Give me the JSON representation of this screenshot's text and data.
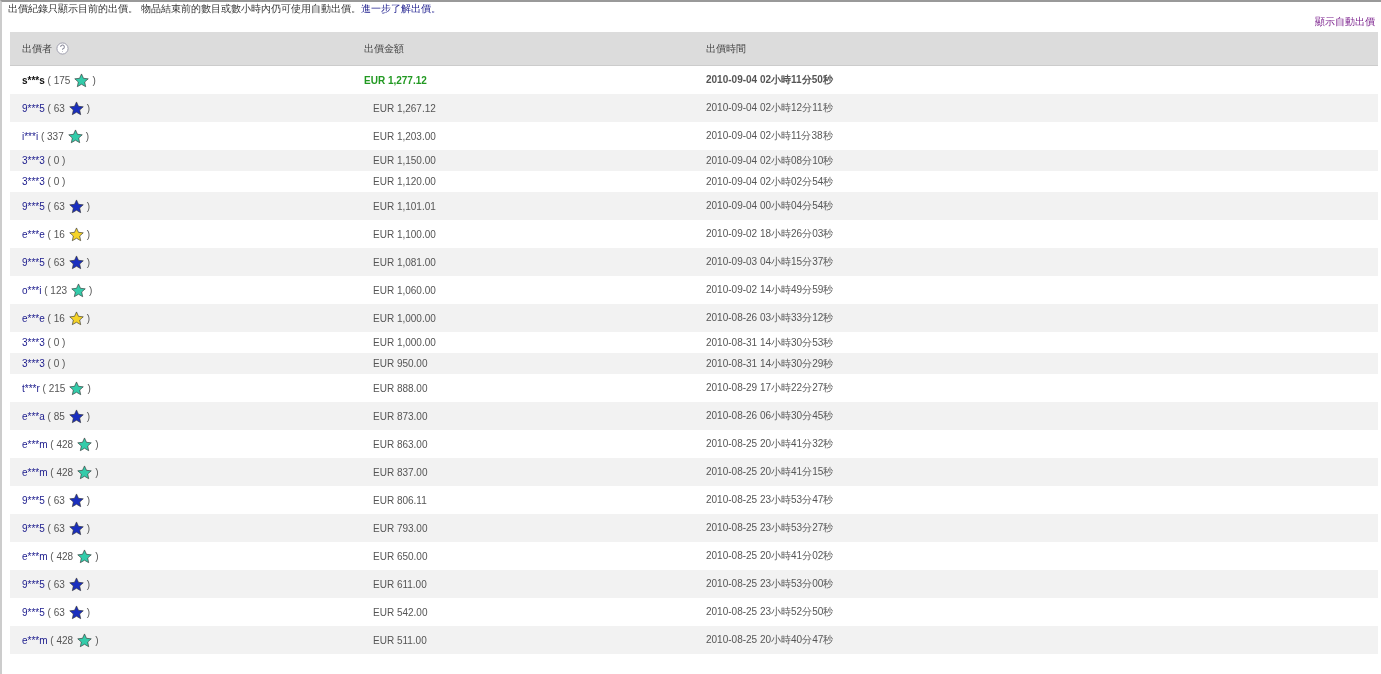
{
  "notice": {
    "text": "出價紀錄只顯示目前的出價。 物品結束前的數目或數小時內仍可使用自動出價。",
    "link": "進一步了解出價。"
  },
  "auto_bid_link": "顯示自動出價",
  "table": {
    "columns": [
      {
        "label": "出價者",
        "help": true
      },
      {
        "label": "出價金額",
        "help": false
      },
      {
        "label": "出價時間",
        "help": false
      }
    ],
    "rows": [
      {
        "bidder": "s***s",
        "score": "( 175",
        "color": "#33ccaa",
        "score_end": ")",
        "leading": true,
        "amount": "EUR 1,277.12",
        "time": "2010-09-04 02小時11分50秒"
      },
      {
        "bidder": "9***5",
        "score": "( 63",
        "color": "#1a2fbf",
        "score_end": ")",
        "leading": false,
        "amount": "EUR 1,267.12",
        "time": "2010-09-04 02小時12分11秒"
      },
      {
        "bidder": "i***i",
        "score": "( 337",
        "color": "#33ccaa",
        "score_end": ")",
        "leading": false,
        "amount": "EUR 1,203.00",
        "time": "2010-09-04 02小時11分38秒"
      },
      {
        "bidder": "3***3",
        "score": "( 0 )",
        "leading": false,
        "amount": "EUR 1,150.00",
        "time": "2010-09-04 02小時08分10秒"
      },
      {
        "bidder": "3***3",
        "score": "( 0 )",
        "leading": false,
        "amount": "EUR 1,120.00",
        "time": "2010-09-04 02小時02分54秒"
      },
      {
        "bidder": "9***5",
        "score": "( 63",
        "color": "#1a2fbf",
        "score_end": ")",
        "leading": false,
        "amount": "EUR 1,101.01",
        "time": "2010-09-04 00小時04分54秒"
      },
      {
        "bidder": "e***e",
        "score": "( 16",
        "color": "#f5d327",
        "score_end": ")",
        "leading": false,
        "amount": "EUR 1,100.00",
        "time": "2010-09-02 18小時26分03秒"
      },
      {
        "bidder": "9***5",
        "score": "( 63",
        "color": "#1a2fbf",
        "score_end": ")",
        "leading": false,
        "amount": "EUR 1,081.00",
        "time": "2010-09-03 04小時15分37秒"
      },
      {
        "bidder": "o***i",
        "score": "( 123",
        "color": "#33ccaa",
        "score_end": ")",
        "leading": false,
        "amount": "EUR 1,060.00",
        "time": "2010-09-02 14小時49分59秒"
      },
      {
        "bidder": "e***e",
        "score": "( 16",
        "color": "#f5d327",
        "score_end": ")",
        "leading": false,
        "amount": "EUR 1,000.00",
        "time": "2010-08-26 03小時33分12秒"
      },
      {
        "bidder": "3***3",
        "score": "( 0 )",
        "leading": false,
        "amount": "EUR 1,000.00",
        "time": "2010-08-31 14小時30分53秒"
      },
      {
        "bidder": "3***3",
        "score": "( 0 )",
        "leading": false,
        "amount": "EUR 950.00",
        "time": "2010-08-31 14小時30分29秒"
      },
      {
        "bidder": "t***r",
        "score": "( 215",
        "color": "#33ccaa",
        "score_end": ")",
        "leading": false,
        "amount": "EUR 888.00",
        "time": "2010-08-29 17小時22分27秒"
      },
      {
        "bidder": "e***a",
        "score": "( 85",
        "color": "#1a2fbf",
        "score_end": ")",
        "leading": false,
        "amount": "EUR 873.00",
        "time": "2010-08-26 06小時30分45秒"
      },
      {
        "bidder": "e***m",
        "score": "( 428",
        "color": "#33ccaa",
        "score_end": ")",
        "leading": false,
        "amount": "EUR 863.00",
        "time": "2010-08-25 20小時41分32秒"
      },
      {
        "bidder": "e***m",
        "score": "( 428",
        "color": "#33ccaa",
        "score_end": ")",
        "leading": false,
        "amount": "EUR 837.00",
        "time": "2010-08-25 20小時41分15秒"
      },
      {
        "bidder": "9***5",
        "score": "( 63",
        "color": "#1a2fbf",
        "score_end": ")",
        "leading": false,
        "amount": "EUR 806.11",
        "time": "2010-08-25 23小時53分47秒"
      },
      {
        "bidder": "9***5",
        "score": "( 63",
        "color": "#1a2fbf",
        "score_end": ")",
        "leading": false,
        "amount": "EUR 793.00",
        "time": "2010-08-25 23小時53分27秒"
      },
      {
        "bidder": "e***m",
        "score": "( 428",
        "color": "#33ccaa",
        "score_end": ")",
        "leading": false,
        "amount": "EUR 650.00",
        "time": "2010-08-25 20小時41分02秒"
      },
      {
        "bidder": "9***5",
        "score": "( 63",
        "color": "#1a2fbf",
        "score_end": ")",
        "leading": false,
        "amount": "EUR 611.00",
        "time": "2010-08-25 23小時53分00秒"
      },
      {
        "bidder": "9***5",
        "score": "( 63",
        "color": "#1a2fbf",
        "score_end": ")",
        "leading": false,
        "amount": "EUR 542.00",
        "time": "2010-08-25 23小時52分50秒"
      },
      {
        "bidder": "e***m",
        "score": "( 428",
        "color": "#33ccaa",
        "score_end": ")",
        "leading": false,
        "amount": "EUR 511.00",
        "time": "2010-08-25 20小時40分47秒"
      }
    ]
  }
}
